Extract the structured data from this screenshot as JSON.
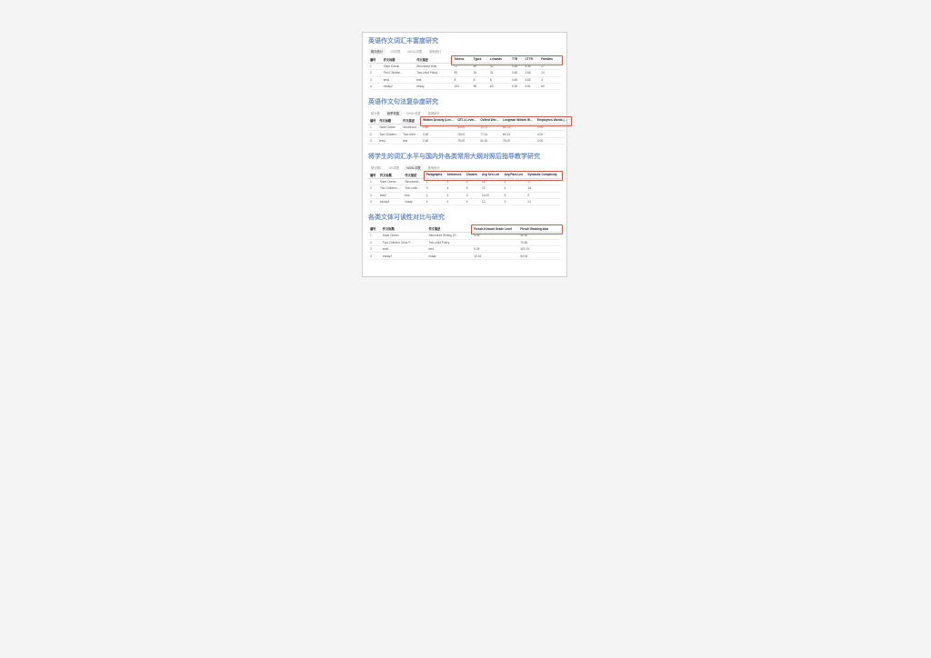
{
  "sections": [
    {
      "title": "英语作文词汇丰富度研究",
      "tabs": [
        "概况统计",
        "GS词表",
        "NGSL词表",
        "其他统计"
      ],
      "active_tab": 0,
      "outline_from_col": 3,
      "headers": [
        "编号",
        "作文标题",
        "作文描述",
        "Tokens",
        "Types",
        "Lemmas",
        "TTR",
        "CTTR",
        "Families"
      ],
      "rows": [
        [
          "1",
          "Save Ocean",
          "Structured Writi…",
          "72",
          "49",
          "42",
          "0.58",
          "4.35",
          "27"
        ],
        [
          "2",
          "Two Children…",
          "Two-child Policy",
          "50",
          "34",
          "31",
          "0.60",
          "3.68",
          "24"
        ],
        [
          "3",
          "test1",
          "test",
          "8",
          "8",
          "6",
          "0.60",
          "3.60",
          "4"
        ],
        [
          "4",
          "essay2",
          "essay",
          "153",
          "95",
          "83",
          "0.53",
          "5.81",
          "69"
        ]
      ]
    },
    {
      "title": "英语作文句法复杂度研究",
      "tabs": [
        "统计数",
        "频率常模",
        "NGSL词表",
        "其他统计"
      ],
      "active_tab": 1,
      "outline_from_col": 3,
      "headers": [
        "编号",
        "作文标题",
        "作文描述",
        "Written Density (Lexi…",
        "CET-4 Level…",
        "Oxford Wor…",
        "Longman Written Wor…",
        "Employees Words (%)…"
      ],
      "rows": [
        [
          "1",
          "Save Ocean",
          "Structured…",
          "0.60",
          "50.00",
          "72.72",
          "62.73",
          "0.00"
        ],
        [
          "2",
          "Two Children…",
          "Two-child…",
          "0.60",
          "78.00",
          "77.14",
          "69.13",
          "4.00"
        ],
        [
          "3",
          "test1",
          "test",
          "0.60",
          "75.00",
          "50.00",
          "75.00",
          "0.00"
        ]
      ]
    },
    {
      "title": "将学生的词汇水平与国内外各类常用大纲对照后指导教学研究",
      "tabs": [
        "统计数1",
        "GS词表",
        "NGSL词表",
        "其他统计"
      ],
      "active_tab": 2,
      "outline_from_col": 3,
      "headers": [
        "编号",
        "作文标题",
        "作文描述",
        "Paragraphs",
        "Sentences",
        "Clauses",
        "Avg Sen Len",
        "Avg Para Len",
        "Syntactic Complexity"
      ],
      "rows": [
        [
          "1",
          "Save Ocean",
          "Structured…",
          "2",
          "4",
          "4",
          "18",
          "4",
          "27"
        ],
        [
          "2",
          "Two Children…",
          "Two-child…",
          "3",
          "4",
          "5",
          "19",
          "4",
          "18"
        ],
        [
          "3",
          "test2",
          "test",
          "4",
          "4",
          "3",
          "10.00",
          "5",
          "9"
        ],
        [
          "4",
          "essay3",
          "essay",
          "4",
          "4",
          "4",
          "12",
          "5",
          "21"
        ]
      ]
    },
    {
      "title": "各类文体可读性对比与研究",
      "tabs": [],
      "active_tab": -1,
      "outline_from_col": 3,
      "headers": [
        "编号",
        "作文标题",
        "作文描述",
        "Flesch-Kincaid Grade Level",
        "Flesch Reading Idea"
      ],
      "rows": [
        [
          "1",
          "Save Ocean",
          "Structured Writing 20…",
          "6.26",
          "50.30"
        ],
        [
          "2",
          "Two Children, More F…",
          "Two-child Policy",
          "",
          "70.56"
        ],
        [
          "3",
          "test1",
          "test",
          "5.28",
          "119.19"
        ],
        [
          "4",
          "essay2",
          "essay",
          "10.34",
          "54.04"
        ]
      ]
    }
  ]
}
